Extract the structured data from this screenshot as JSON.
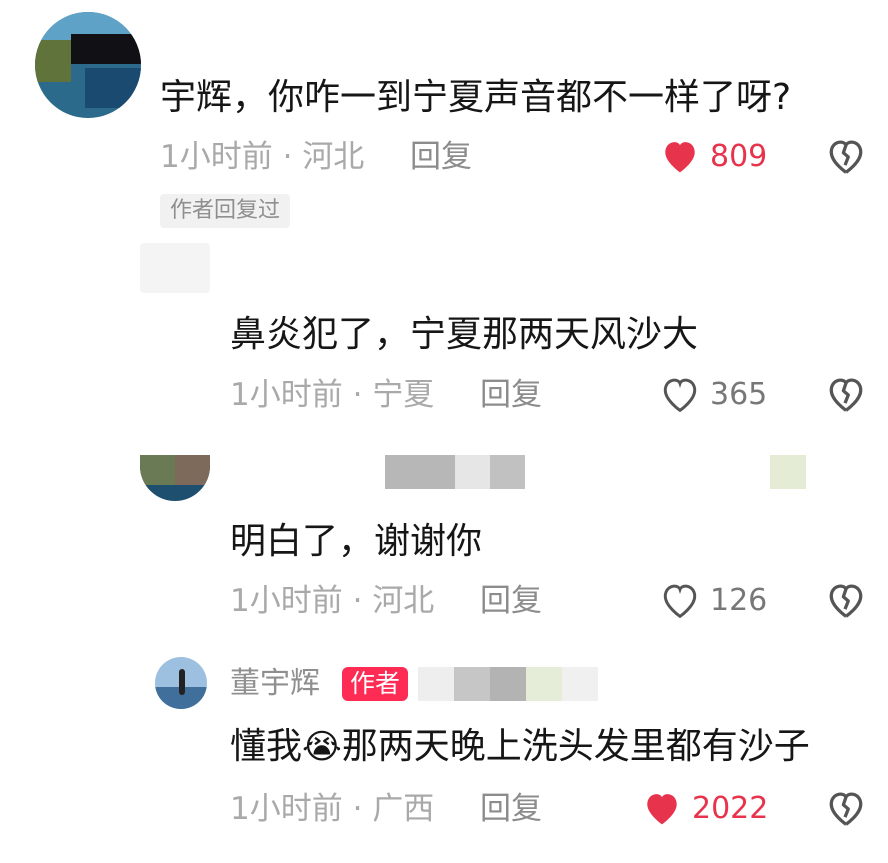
{
  "comments": [
    {
      "text": "宇辉，你咋一到宁夏声音都不一样了呀?",
      "time": "1小时前",
      "location": "河北",
      "reply_label": "回复",
      "likes": "809",
      "liked": true,
      "tag": "作者回复过"
    },
    {
      "text": "鼻炎犯了，宁夏那两天风沙大",
      "time": "1小时前",
      "location": "宁夏",
      "reply_label": "回复",
      "likes": "365",
      "liked": false
    },
    {
      "text": "明白了，谢谢你",
      "time": "1小时前",
      "location": "河北",
      "reply_label": "回复",
      "likes": "126",
      "liked": false
    },
    {
      "user": "董宇辉",
      "badge": "作者",
      "text_before": "懂我",
      "emoji": "😭",
      "text_after": "那两天晚上洗头发里都有沙子",
      "time": "1小时前",
      "location": "广西",
      "reply_label": "回复",
      "likes": "2022",
      "liked": true
    }
  ],
  "separator": "·",
  "colors": {
    "like_active": "#e8334d",
    "author_badge": "#fe2c55"
  },
  "icons": [
    "heart-filled-icon",
    "heart-outline-icon",
    "broken-heart-icon"
  ]
}
